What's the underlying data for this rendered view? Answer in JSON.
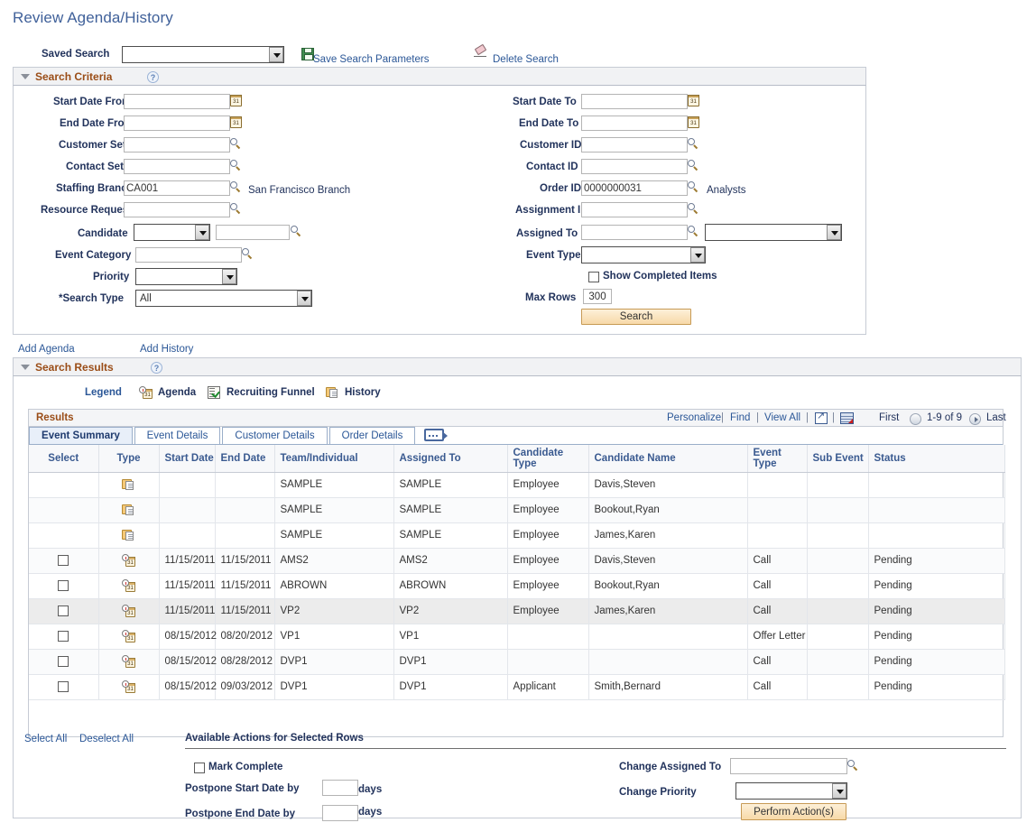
{
  "page": {
    "title": "Review Agenda/History"
  },
  "saved_search": {
    "label": "Saved Search",
    "value": "",
    "save_link": "Save Search Parameters",
    "delete_link": "Delete Search",
    "save_icon": "floppy-disk-icon",
    "delete_icon": "eraser-icon"
  },
  "search_criteria": {
    "title": "Search Criteria",
    "help_icon": "?",
    "left": [
      {
        "label": "Start Date From",
        "value": "",
        "control": "date"
      },
      {
        "label": "End Date From",
        "value": "",
        "control": "date"
      },
      {
        "label": "Customer SetID",
        "value": "",
        "control": "lookup"
      },
      {
        "label": "Contact SetID",
        "value": "",
        "control": "lookup"
      },
      {
        "label": "Staffing Branch",
        "value": "CA001",
        "control": "lookup",
        "suffix": "San Francisco Branch"
      },
      {
        "label": "Resource Request",
        "value": "",
        "control": "lookup"
      },
      {
        "label": "Candidate",
        "value": "",
        "control": "select-lookup"
      },
      {
        "label": "Event Category",
        "value": "",
        "control": "lookup"
      },
      {
        "label": "Priority",
        "value": "",
        "control": "select"
      },
      {
        "label": "*Search Type",
        "value": "All",
        "control": "select-wide"
      }
    ],
    "right": [
      {
        "label": "Start Date To",
        "value": "",
        "control": "date"
      },
      {
        "label": "End Date To",
        "value": "",
        "control": "date"
      },
      {
        "label": "Customer ID",
        "value": "",
        "control": "lookup"
      },
      {
        "label": "Contact ID",
        "value": "",
        "control": "lookup"
      },
      {
        "label": "Order ID",
        "value": "0000000031",
        "control": "lookup",
        "suffix": "Analysts"
      },
      {
        "label": "Assignment ID",
        "value": "",
        "control": "lookup"
      },
      {
        "label": "Assigned To",
        "value": "",
        "control": "lookup-select"
      },
      {
        "label": "Event Type",
        "value": "",
        "control": "select"
      }
    ],
    "show_completed": {
      "label": "Show Completed Items",
      "checked": false
    },
    "max_rows": {
      "label": "Max Rows",
      "value": "300"
    },
    "search_button": "Search"
  },
  "links": {
    "add_agenda": "Add Agenda",
    "add_history": "Add History"
  },
  "search_results": {
    "title": "Search Results",
    "help_icon": "?",
    "legend": {
      "label": "Legend",
      "items": [
        {
          "icon": "agenda-calendar-icon",
          "label": "Agenda"
        },
        {
          "icon": "recruiting-funnel-icon",
          "label": "Recruiting Funnel"
        },
        {
          "icon": "history-document-icon",
          "label": "History"
        }
      ]
    },
    "grid": {
      "title": "Results",
      "toolbar": {
        "personalize": "Personalize",
        "find": "Find",
        "view_all": "View All",
        "expand_icon": "new-window-icon",
        "download_icon": "download-grid-icon",
        "first": "First",
        "range": "1-9 of 9",
        "last": "Last",
        "prev_icon": "prev-arrow-icon",
        "next_icon": "next-arrow-icon"
      },
      "tabs": [
        {
          "label": "Event Summary",
          "active": true
        },
        {
          "label": "Event Details",
          "active": false
        },
        {
          "label": "Customer Details",
          "active": false
        },
        {
          "label": "Order Details",
          "active": false
        }
      ],
      "tab_expand_icon": "show-all-columns-icon",
      "columns": [
        "Select",
        "Type",
        "Start Date",
        "End Date",
        "Team/Individual",
        "Assigned To",
        "Candidate Type",
        "Candidate Name",
        "Event Type",
        "Sub Event",
        "Status"
      ],
      "rows": [
        {
          "select": false,
          "selectable": false,
          "type": "history-document-icon",
          "start_date": "",
          "end_date": "",
          "team": "SAMPLE",
          "assigned_to": "SAMPLE",
          "candidate_type": "Employee",
          "candidate_name": "Davis,Steven",
          "event_type": "",
          "sub_event": "",
          "status": "",
          "highlight": false
        },
        {
          "select": false,
          "selectable": false,
          "type": "history-document-icon",
          "start_date": "",
          "end_date": "",
          "team": "SAMPLE",
          "assigned_to": "SAMPLE",
          "candidate_type": "Employee",
          "candidate_name": "Bookout,Ryan",
          "event_type": "",
          "sub_event": "",
          "status": "",
          "highlight": false
        },
        {
          "select": false,
          "selectable": false,
          "type": "history-document-icon",
          "start_date": "",
          "end_date": "",
          "team": "SAMPLE",
          "assigned_to": "SAMPLE",
          "candidate_type": "Employee",
          "candidate_name": "James,Karen",
          "event_type": "",
          "sub_event": "",
          "status": "",
          "highlight": false
        },
        {
          "select": false,
          "selectable": true,
          "type": "agenda-calendar-icon",
          "start_date": "11/15/2011",
          "end_date": "11/15/2011",
          "team": "AMS2",
          "assigned_to": "AMS2",
          "candidate_type": "Employee",
          "candidate_name": "Davis,Steven",
          "event_type": "Call",
          "sub_event": "",
          "status": "Pending",
          "highlight": false
        },
        {
          "select": false,
          "selectable": true,
          "type": "agenda-calendar-icon",
          "start_date": "11/15/2011",
          "end_date": "11/15/2011",
          "team": "ABROWN",
          "assigned_to": "ABROWN",
          "candidate_type": "Employee",
          "candidate_name": "Bookout,Ryan",
          "event_type": "Call",
          "sub_event": "",
          "status": "Pending",
          "highlight": false
        },
        {
          "select": false,
          "selectable": true,
          "type": "agenda-calendar-icon",
          "start_date": "11/15/2011",
          "end_date": "11/15/2011",
          "team": "VP2",
          "assigned_to": "VP2",
          "candidate_type": "Employee",
          "candidate_name": "James,Karen",
          "event_type": "Call",
          "sub_event": "",
          "status": "Pending",
          "highlight": true
        },
        {
          "select": false,
          "selectable": true,
          "type": "agenda-calendar-icon",
          "start_date": "08/15/2012",
          "end_date": "08/20/2012",
          "team": "VP1",
          "assigned_to": "VP1",
          "candidate_type": "",
          "candidate_name": "",
          "event_type": "Offer Letter",
          "sub_event": "",
          "status": "Pending",
          "highlight": false
        },
        {
          "select": false,
          "selectable": true,
          "type": "agenda-calendar-icon",
          "start_date": "08/15/2012",
          "end_date": "08/28/2012",
          "team": "DVP1",
          "assigned_to": "DVP1",
          "candidate_type": "",
          "candidate_name": "",
          "event_type": "Call",
          "sub_event": "",
          "status": "Pending",
          "highlight": false
        },
        {
          "select": false,
          "selectable": true,
          "type": "agenda-calendar-icon",
          "start_date": "08/15/2012",
          "end_date": "09/03/2012",
          "team": "DVP1",
          "assigned_to": "DVP1",
          "candidate_type": "Applicant",
          "candidate_name": "Smith,Bernard",
          "event_type": "Call",
          "sub_event": "",
          "status": "Pending",
          "highlight": false
        }
      ]
    },
    "footer": {
      "select_all": "Select All",
      "deselect_all": "Deselect All",
      "actions_title": "Available Actions for Selected Rows",
      "mark_complete": {
        "label": "Mark Complete",
        "checked": false
      },
      "postpone_start": {
        "label": "Postpone Start Date by",
        "value": "",
        "unit": "days"
      },
      "postpone_end": {
        "label": "Postpone End Date by",
        "value": "",
        "unit": "days"
      },
      "change_assigned_to": {
        "label": "Change Assigned To",
        "value": ""
      },
      "change_priority": {
        "label": "Change Priority",
        "value": ""
      },
      "perform_button": "Perform Action(s)"
    }
  }
}
